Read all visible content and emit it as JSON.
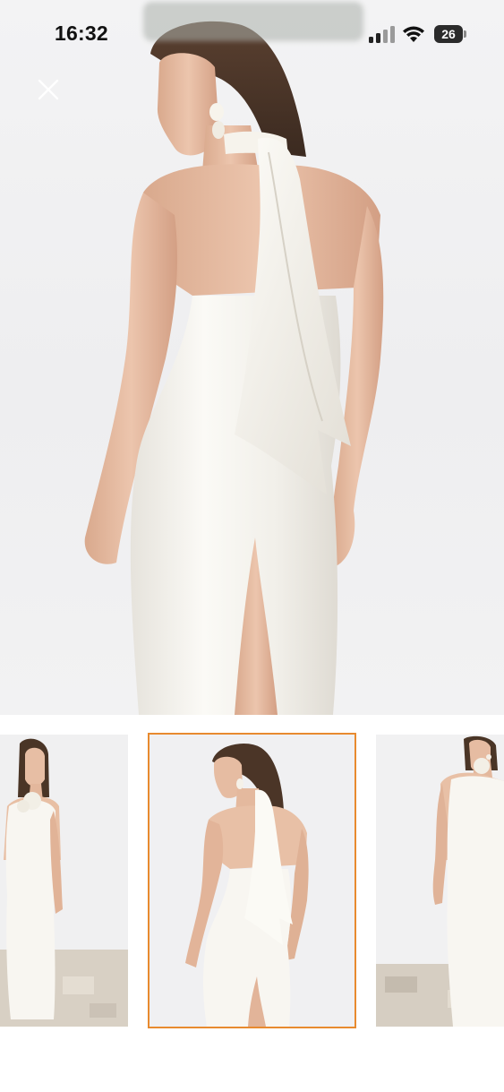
{
  "status_bar": {
    "time": "16:32",
    "battery_level": "26",
    "icons": [
      "signal-icon",
      "wifi-icon",
      "battery-icon"
    ]
  },
  "viewer": {
    "close_icon": "close-icon",
    "main_image": "white-halter-maxi-dress-back-view",
    "selected_index": 1
  },
  "thumbnails": [
    {
      "name": "white-dress-front-view"
    },
    {
      "name": "white-dress-back-view",
      "selected": true
    },
    {
      "name": "white-dress-side-view"
    }
  ],
  "colors": {
    "selected_outline": "#e88a2f",
    "background": "#ffffff",
    "dress": "#f6f4ef"
  }
}
